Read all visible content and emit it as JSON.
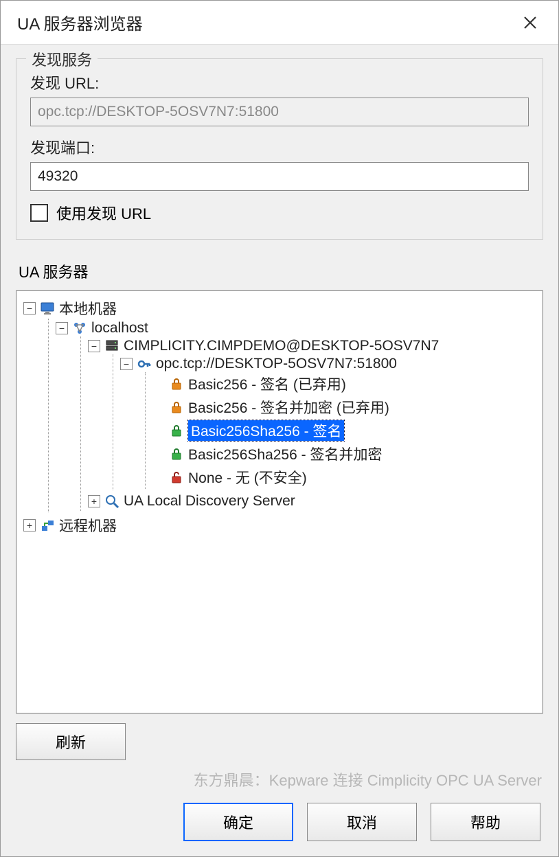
{
  "window": {
    "title": "UA 服务器浏览器"
  },
  "discovery": {
    "legend": "发现服务",
    "url_label": "发现 URL:",
    "url_value": "opc.tcp://DESKTOP-5OSV7N7:51800",
    "port_label": "发现端口:",
    "port_value": "49320",
    "use_url_label": "使用发现 URL"
  },
  "servers": {
    "label": "UA 服务器",
    "refresh": "刷新",
    "tree": {
      "local": "本地机器",
      "localhost": "localhost",
      "cimp": "CIMPLICITY.CIMPDEMO@DESKTOP-5OSV7N7",
      "endpoint": "opc.tcp://DESKTOP-5OSV7N7:51800",
      "p0": "Basic256 - 签名 (已弃用)",
      "p1": "Basic256 - 签名并加密 (已弃用)",
      "p2": "Basic256Sha256 - 签名",
      "p3": "Basic256Sha256 - 签名并加密",
      "p4": "None - 无 (不安全)",
      "discovery_srv": "UA Local Discovery Server",
      "remote": "远程机器"
    }
  },
  "watermark": "东方鼎晨：Kepware 连接 Cimplicity OPC UA Server",
  "buttons": {
    "ok": "确定",
    "cancel": "取消",
    "help": "帮助"
  }
}
